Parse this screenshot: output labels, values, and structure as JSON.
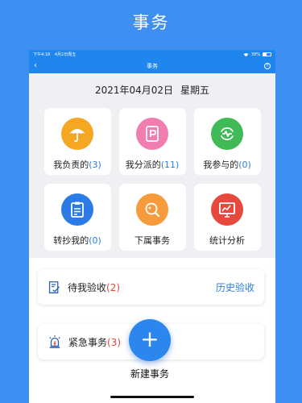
{
  "banner": {
    "title": "事务"
  },
  "status_bar": {
    "time": "下午4:18",
    "date": "4月2日周五",
    "battery": "39%"
  },
  "nav": {
    "title": "事务",
    "back_icon": "chevron-left-icon",
    "help_icon": "question-circle-icon"
  },
  "date": {
    "date": "2021年04月02日",
    "weekday": "星期五"
  },
  "tiles": [
    {
      "label": "我负责的",
      "count": "(3)",
      "icon": "umbrella-icon",
      "color": "#f5a623"
    },
    {
      "label": "我分派的",
      "count": "(11)",
      "icon": "assign-doc-icon",
      "color": "#f07cb0"
    },
    {
      "label": "我参与的",
      "count": "(0)",
      "icon": "participate-icon",
      "color": "#3fba57"
    },
    {
      "label": "转抄我的",
      "count": "(0)",
      "icon": "clipboard-icon",
      "color": "#2b7ae8"
    },
    {
      "label": "下属事务",
      "count": "",
      "icon": "subordinate-search-icon",
      "color": "#f79a3c"
    },
    {
      "label": "统计分析",
      "count": "",
      "icon": "chart-analysis-icon",
      "color": "#e6493e"
    }
  ],
  "cards": {
    "pending": {
      "label": "待我验收",
      "count": "(2)",
      "link": "历史验收",
      "icon": "acceptance-icon"
    },
    "urgent": {
      "label": "紧急事务",
      "count": "(3)",
      "icon": "alarm-light-icon"
    }
  },
  "fab": {
    "symbol": "+",
    "label": "新建事务"
  },
  "colors": {
    "brand": "#3d8ff2",
    "accent": "#2a7be4",
    "alert": "#e0483b"
  }
}
